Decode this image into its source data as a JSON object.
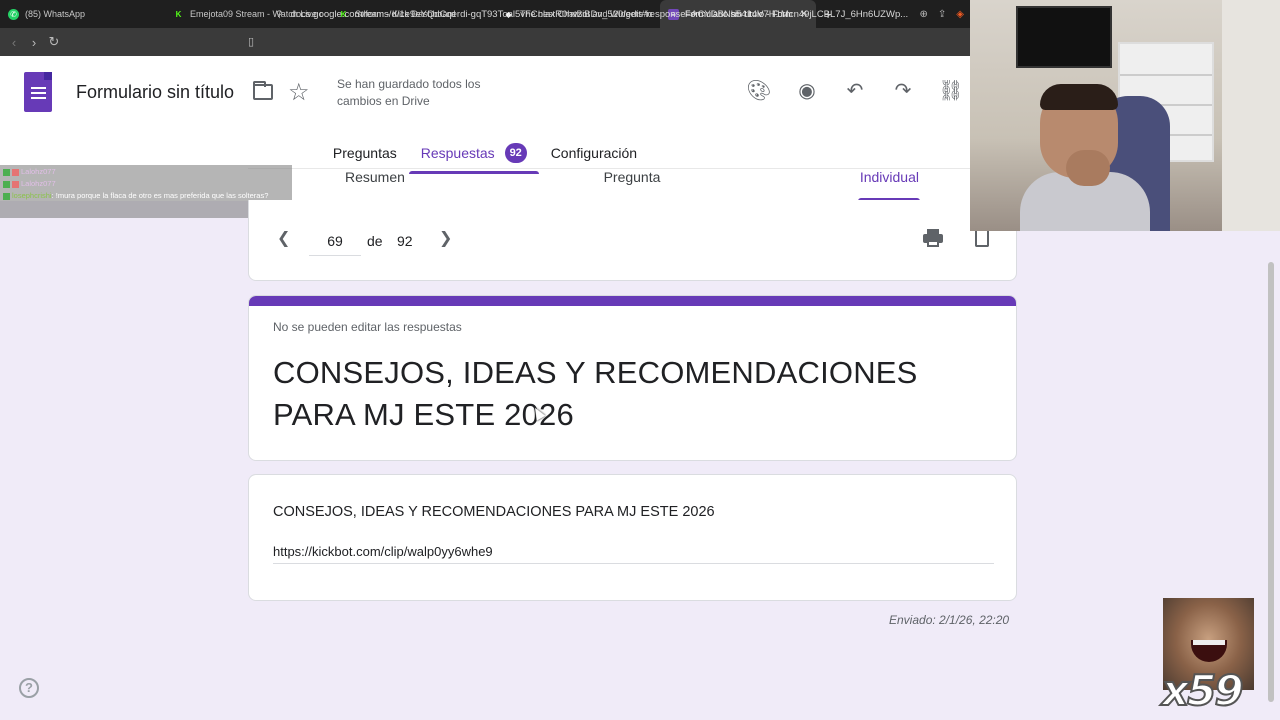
{
  "browser": {
    "tabs": [
      {
        "title": "(85) WhatsApp",
        "icon": "whatsapp-icon",
        "color": "#25d366"
      },
      {
        "title": "Emejota09 Stream - Watch Live on K",
        "icon": "kick-icon",
        "color": "#53fc18"
      },
      {
        "title": "Stream - Kick Dashboard",
        "icon": "kick-icon",
        "color": "#53fc18"
      },
      {
        "title": "The best ChatBot and Widgets for Ki",
        "icon": "botrix-icon",
        "color": "#ffffff"
      },
      {
        "title": "Formulario sin título - Formulario",
        "icon": "forms-icon",
        "color": "#7248b9"
      }
    ],
    "new_tab": "+",
    "close": "✕",
    "url": "docs.google.com/forms/d/1e9eYQdCqerdi-gqT93Toal5vFCnlaxR0hvziBDv_520/edit#response=ACYDBNh5414V7H1Mcn49jLCBL7J_6Hn6UZWp..."
  },
  "header": {
    "title": "Formulario sin título",
    "saved_status": "Se han guardado todos los cambios en Drive",
    "tabs": {
      "questions": "Preguntas",
      "responses": "Respuestas",
      "responses_count": "92",
      "settings": "Configuración"
    },
    "sub_tabs": {
      "summary": "Resumen",
      "question": "Pregunta",
      "individual": "Individual"
    }
  },
  "chat": {
    "lines": [
      {
        "user": "Lalohz077",
        "message": ""
      },
      {
        "user": "Lalohz077",
        "message": ""
      },
      {
        "user": "losephcrishi",
        "message": "!mura porque la flaca de otro es mas preferida que las solteras?"
      }
    ]
  },
  "pager": {
    "current": "69",
    "of_label": "de",
    "total": "92"
  },
  "response": {
    "no_edit_notice": "No se pueden editar las respuestas",
    "form_title": "CONSEJOS, IDEAS Y RECOMENDACIONES PARA MJ ESTE 2026",
    "question": "CONSEJOS, IDEAS Y RECOMENDACIONES PARA MJ ESTE 2026",
    "answer": "https://kickbot.com/clip/walp0yy6whe9",
    "submitted": "Enviado: 2/1/26, 22:20"
  },
  "overlay": {
    "emote_count": "x59"
  },
  "colors": {
    "accent": "#673ab7",
    "background": "#f0ebf8"
  }
}
